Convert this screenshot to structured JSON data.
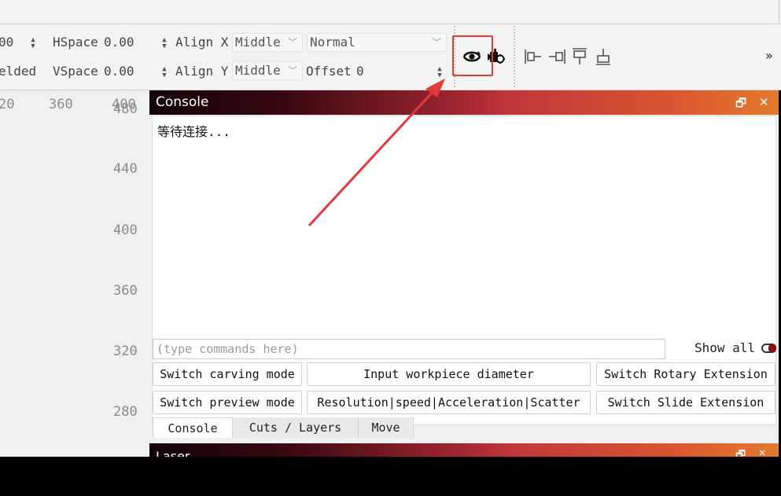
{
  "toolbar": {
    "row1": {
      "partial_value": "00",
      "hspace_label": "HSpace",
      "hspace_value": "0.00",
      "align_x_label": "Align X",
      "align_x_value": "Middle",
      "mode_value": "Normal"
    },
    "row2": {
      "partial_label": "elded",
      "vspace_label": "VSpace",
      "vspace_value": "0.00",
      "align_y_label": "Align Y",
      "align_y_value": "Middle",
      "offset_label": "Offset",
      "offset_value": "0"
    },
    "more_label": "»"
  },
  "ruler": {
    "top_labels": [
      "20",
      "360",
      "400"
    ],
    "top_overlap_label": "480",
    "vertical_labels": [
      "440",
      "400",
      "360",
      "320",
      "280"
    ]
  },
  "console": {
    "title": "Console",
    "output_text": "等待连接...",
    "input_placeholder": "(type commands here)",
    "show_all_label": "Show all",
    "buttons": {
      "switch_carving": "Switch carving mode",
      "input_diameter": "Input workpiece diameter",
      "switch_rotary": "Switch Rotary Extension",
      "switch_preview": "Switch preview mode",
      "resolution": "Resolution|speed|Acceleration|Scatter",
      "switch_slide": "Switch Slide Extension"
    },
    "tabs": [
      "Console",
      "Cuts / Layers",
      "Move"
    ]
  },
  "laser_panel": {
    "title": "Laser"
  },
  "colors": {
    "highlight": "#e23a3a",
    "title_gradient_start": "#120408",
    "title_gradient_end": "#e47a2e"
  }
}
